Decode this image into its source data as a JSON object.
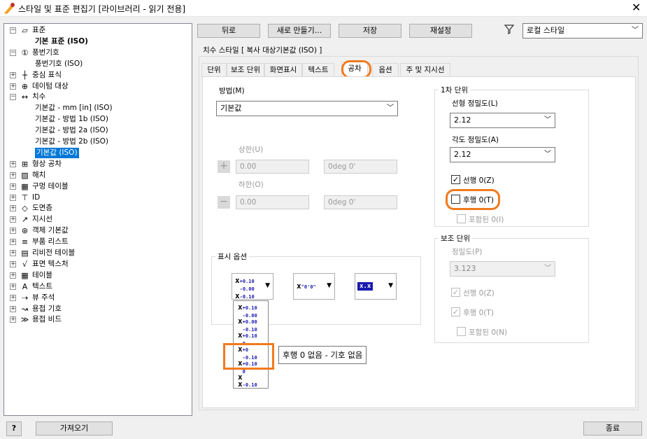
{
  "window": {
    "title": "스타일 및 표준 편집기 [라이브러리 - 읽기 전용]",
    "close": "✕"
  },
  "tree": {
    "items": [
      {
        "label": "표준",
        "icon": "standard-icon",
        "level": 0,
        "exp": "−"
      },
      {
        "label": "기본 표준 (ISO)",
        "level": 1,
        "bold": true
      },
      {
        "label": "풍번기호",
        "icon": "balloon-icon",
        "level": 0,
        "exp": "−"
      },
      {
        "label": "풍번기호 (ISO)",
        "level": 1
      },
      {
        "label": "중심 표식",
        "icon": "center-mark-icon",
        "level": 0,
        "exp": "+"
      },
      {
        "label": "데이텀 대상",
        "icon": "datum-target-icon",
        "level": 0,
        "exp": "+"
      },
      {
        "label": "치수",
        "icon": "dimension-icon",
        "level": 0,
        "exp": "−"
      },
      {
        "label": "기본값 - mm [in] (ISO)",
        "level": 1
      },
      {
        "label": "기본값 - 방법 1b (ISO)",
        "level": 1
      },
      {
        "label": "기본값 - 방법 2a (ISO)",
        "level": 1
      },
      {
        "label": "기본값 - 방법 2b (ISO)",
        "level": 1
      },
      {
        "label": "기본값 (ISO)",
        "level": 1,
        "selected": true
      },
      {
        "label": "형상 공차",
        "icon": "feature-control-icon",
        "level": 0,
        "exp": "+"
      },
      {
        "label": "해치",
        "icon": "hatch-icon",
        "level": 0,
        "exp": "+"
      },
      {
        "label": "구멍 테이블",
        "icon": "hole-table-icon",
        "level": 0,
        "exp": "+"
      },
      {
        "label": "ID",
        "icon": "id-icon",
        "level": 0,
        "exp": "+"
      },
      {
        "label": "도면층",
        "icon": "layers-icon",
        "level": 0,
        "exp": "+"
      },
      {
        "label": "지시선",
        "icon": "leader-icon",
        "level": 0,
        "exp": "+"
      },
      {
        "label": "객체 기본값",
        "icon": "object-defaults-icon",
        "level": 0,
        "exp": "+"
      },
      {
        "label": "부품 리스트",
        "icon": "parts-list-icon",
        "level": 0,
        "exp": "+"
      },
      {
        "label": "리비전 테이블",
        "icon": "revision-table-icon",
        "level": 0,
        "exp": "+"
      },
      {
        "label": "표면 텍스처",
        "icon": "surface-texture-icon",
        "level": 0,
        "exp": "+"
      },
      {
        "label": "테이블",
        "icon": "table-icon",
        "level": 0,
        "exp": "+"
      },
      {
        "label": "텍스트",
        "icon": "text-icon",
        "level": 0,
        "exp": "+"
      },
      {
        "label": "뷰 주석",
        "icon": "view-annotation-icon",
        "level": 0,
        "exp": "+"
      },
      {
        "label": "용접 기호",
        "icon": "weld-symbol-icon",
        "level": 0,
        "exp": "+"
      },
      {
        "label": "용접 비드",
        "icon": "weld-bead-icon",
        "level": 0,
        "exp": "+"
      }
    ]
  },
  "toolbar": {
    "back": "뒤로",
    "new": "새로 만들기...",
    "save": "저장",
    "reset": "재설정",
    "filter_value": "로컬 스타일"
  },
  "style_title": "치수 스타일 [ 복사 대상기본값 (ISO) ]",
  "tabs": [
    "단위",
    "보조 단위",
    "화면표시",
    "텍스트",
    "공차",
    "옵션",
    "주 및 지시선"
  ],
  "tolerance": {
    "method_label": "방법(M)",
    "method_value": "기본값",
    "upper_label": "상한(U)",
    "upper_value": "0.00",
    "upper_angle": "0deg 0'",
    "lower_label": "하한(O)",
    "lower_value": "0.00",
    "lower_angle": "0deg 0'",
    "plus": "+",
    "minus": "−"
  },
  "display_options": {
    "label": "표시 옵션",
    "tooltip": "후행 0 없음 - 기호 없음"
  },
  "primary": {
    "label": "1차 단위",
    "linear_label": "선형 정밀도(L)",
    "linear_value": "2.12",
    "angular_label": "각도 정밀도(A)",
    "angular_value": "2.12",
    "leading": "선행 0(Z)",
    "trailing": "후행 0(T)",
    "included": "포함된 0(I)"
  },
  "alternate": {
    "label": "보조 단위",
    "precision_label": "정밀도(P)",
    "precision_value": "3.123",
    "leading": "선행 0(Z)",
    "trailing": "후행 0(T)",
    "included": "포함된 0(N)"
  },
  "bottom": {
    "help": "?",
    "import": "가져오기",
    "done": "종료"
  }
}
